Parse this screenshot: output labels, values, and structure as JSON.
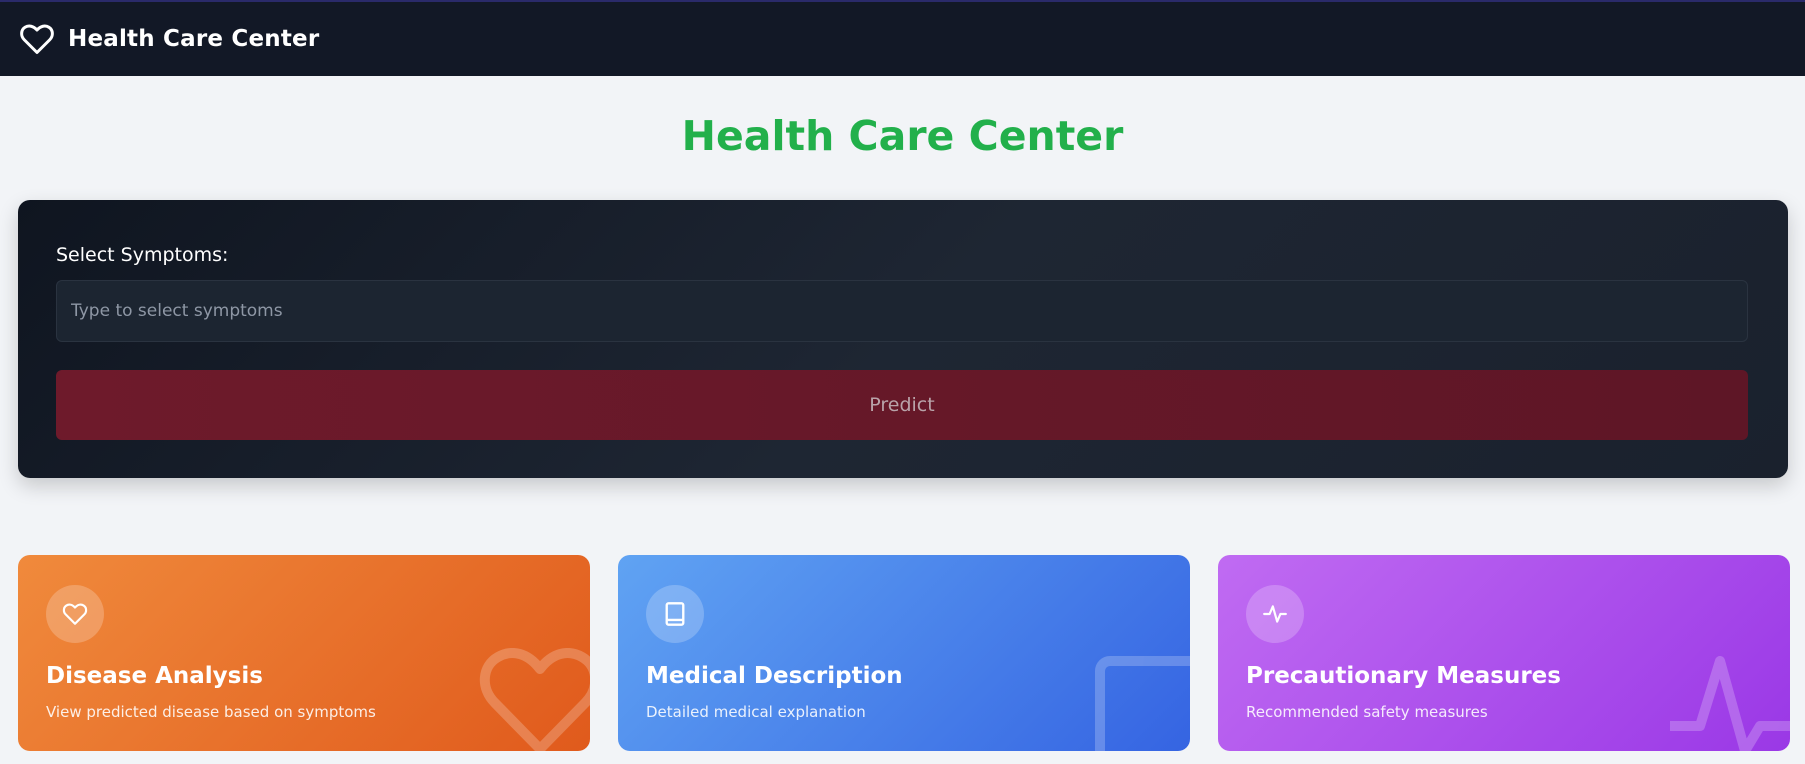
{
  "navbar": {
    "brand_icon": "heart-outline-icon",
    "brand_name": "Health Care Center"
  },
  "page": {
    "title": "Health Care Center",
    "title_color": "#22b04b"
  },
  "form": {
    "label": "Select Symptoms:",
    "input_value": "",
    "input_placeholder": "Type to select symptoms",
    "predict_label": "Predict"
  },
  "cards": [
    {
      "title": "Disease Analysis",
      "subtitle": "View predicted disease based on symptoms",
      "icon": "heart-icon",
      "color": "#ea6f2a"
    },
    {
      "title": "Medical Description",
      "subtitle": "Detailed medical explanation",
      "icon": "book-icon",
      "color": "#4a84ea"
    },
    {
      "title": "Precautionary Measures",
      "subtitle": "Recommended safety measures",
      "icon": "activity-icon",
      "color": "#ad52ec"
    }
  ]
}
